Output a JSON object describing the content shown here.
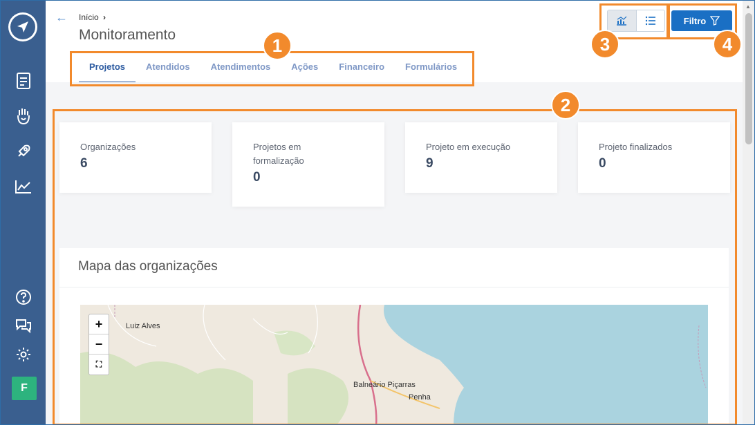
{
  "header": {
    "breadcrumb": "Início",
    "breadcrumb_sep": "›",
    "title": "Monitoramento",
    "filter_label": "Filtro"
  },
  "tabs": [
    {
      "label": "Projetos",
      "active": true
    },
    {
      "label": "Atendidos",
      "active": false
    },
    {
      "label": "Atendimentos",
      "active": false
    },
    {
      "label": "Ações",
      "active": false
    },
    {
      "label": "Financeiro",
      "active": false
    },
    {
      "label": "Formulários",
      "active": false
    }
  ],
  "stats": [
    {
      "label": "Organizações",
      "value": "6"
    },
    {
      "label": "Projetos em formalização",
      "value": "0"
    },
    {
      "label": "Projeto em execução",
      "value": "9"
    },
    {
      "label": "Projeto finalizados",
      "value": "0"
    }
  ],
  "map": {
    "title": "Mapa das organizações",
    "zoom_in": "+",
    "zoom_out": "−",
    "places": [
      "Luiz Alves",
      "Balneário Piçarras",
      "Penha"
    ]
  },
  "user": {
    "avatar_initial": "F"
  },
  "annotations": [
    "1",
    "2",
    "3",
    "4"
  ],
  "colors": {
    "sidebar": "#3a5f8f",
    "accent": "#1a6fc4",
    "annotation": "#f28a2c",
    "avatar": "#2db37e",
    "sea": "#aad3df"
  },
  "icons": {
    "sidebar": [
      "document-icon",
      "hand-heart-icon",
      "rocket-icon",
      "chart-line-icon"
    ],
    "sidebar_bottom": [
      "help-icon",
      "chat-icon",
      "settings-icon"
    ]
  }
}
